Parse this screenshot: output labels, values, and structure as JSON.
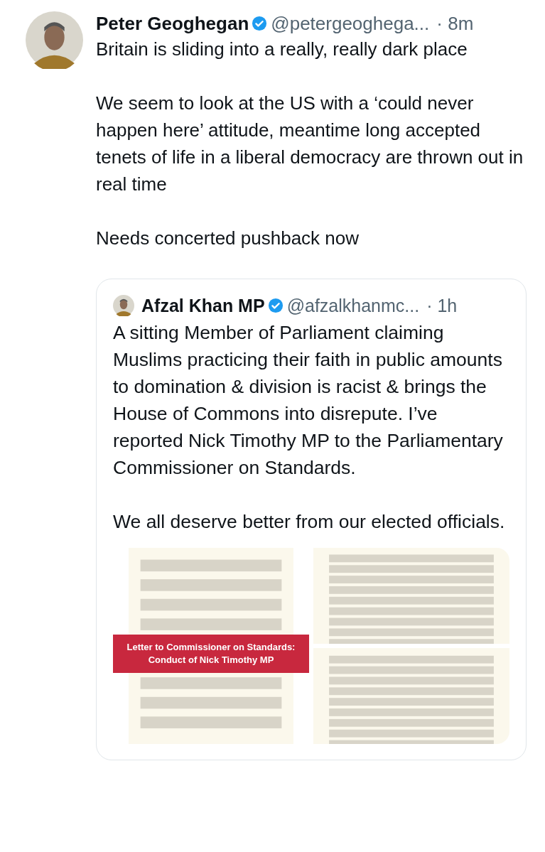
{
  "post": {
    "author": "Peter Geoghegan",
    "verified": true,
    "handle": "@petergeoghega...",
    "time": "· 8m",
    "paragraphs": [
      "Britain is sliding into a really, really dark place",
      "We seem to look at the US with a ‘could never happen here’ attitude, meantime long accepted tenets of life in a liberal democracy are thrown out in real time",
      "Needs concerted pushback now"
    ],
    "quote": {
      "author": "Afzal Khan MP",
      "verified": true,
      "handle": "@afzalkhanmc...",
      "time": "· 1h",
      "paragraphs": [
        "A sitting Member of Parliament claiming Muslims practicing their faith in public amounts to domination & division is racist & brings the House of Commons into disrepute. I’ve reported Nick Timothy MP to the Parliamentary Commissioner on Standards.",
        "We all deserve better from our elected officials."
      ],
      "media": [
        {
          "kind": "picture",
          "banner": "Letter to Commissioner on Standards: Conduct of Nick Timothy MP"
        },
        {
          "kind": "picture"
        },
        {
          "kind": "picture"
        }
      ]
    }
  }
}
